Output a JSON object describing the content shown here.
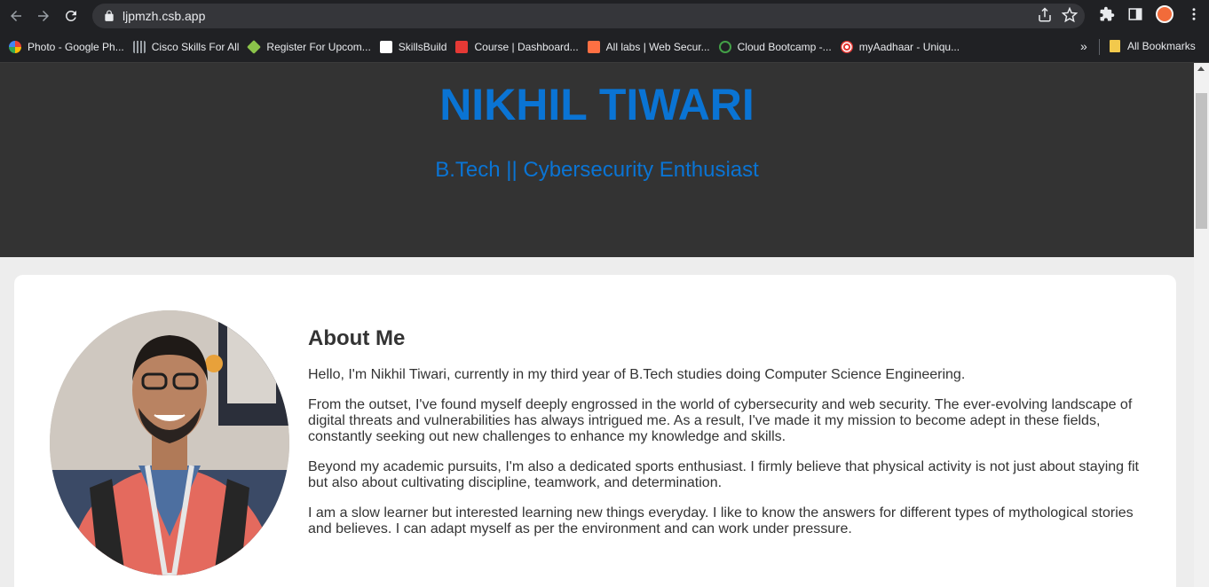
{
  "browser": {
    "url": "ljpmzh.csb.app",
    "bookmarks": [
      {
        "label": "Photo - Google Ph...",
        "color": "#ea4335"
      },
      {
        "label": "Cisco Skills For All",
        "color": "#9aa0a6"
      },
      {
        "label": "Register For Upcom...",
        "color": "#8bc34a"
      },
      {
        "label": "SkillsBuild",
        "color": "#ffffff"
      },
      {
        "label": "Course | Dashboard...",
        "color": "#e53935"
      },
      {
        "label": "All labs | Web Secur...",
        "color": "#ff7043"
      },
      {
        "label": "Cloud Bootcamp -...",
        "color": "#43a047"
      },
      {
        "label": "myAadhaar - Uniqu...",
        "color": "#e53935"
      }
    ],
    "more_label": "»",
    "all_bookmarks": "All Bookmarks"
  },
  "hero": {
    "name": "NIKHIL TIWARI",
    "tagline": "B.Tech || Cybersecurity Enthusiast"
  },
  "about": {
    "heading": "About Me",
    "paragraphs": [
      "Hello, I'm Nikhil Tiwari, currently in my third year of B.Tech studies doing Computer Science Engineering.",
      "From the outset, I've found myself deeply engrossed in the world of cybersecurity and web security. The ever-evolving landscape of digital threats and vulnerabilities has always intrigued me. As a result, I've made it my mission to become adept in these fields, constantly seeking out new challenges to enhance my knowledge and skills.",
      "Beyond my academic pursuits, I'm also a dedicated sports enthusiast. I firmly believe that physical activity is not just about staying fit but also about cultivating discipline, teamwork, and determination.",
      "I am a slow learner but interested learning new things everyday. I like to know the answers for different types of mythological stories and believes. I can adapt myself as per the environment and can work under pressure."
    ]
  },
  "colors": {
    "accent": "#0a74d4",
    "hero_bg": "#333333",
    "page_bg": "#ededed"
  }
}
